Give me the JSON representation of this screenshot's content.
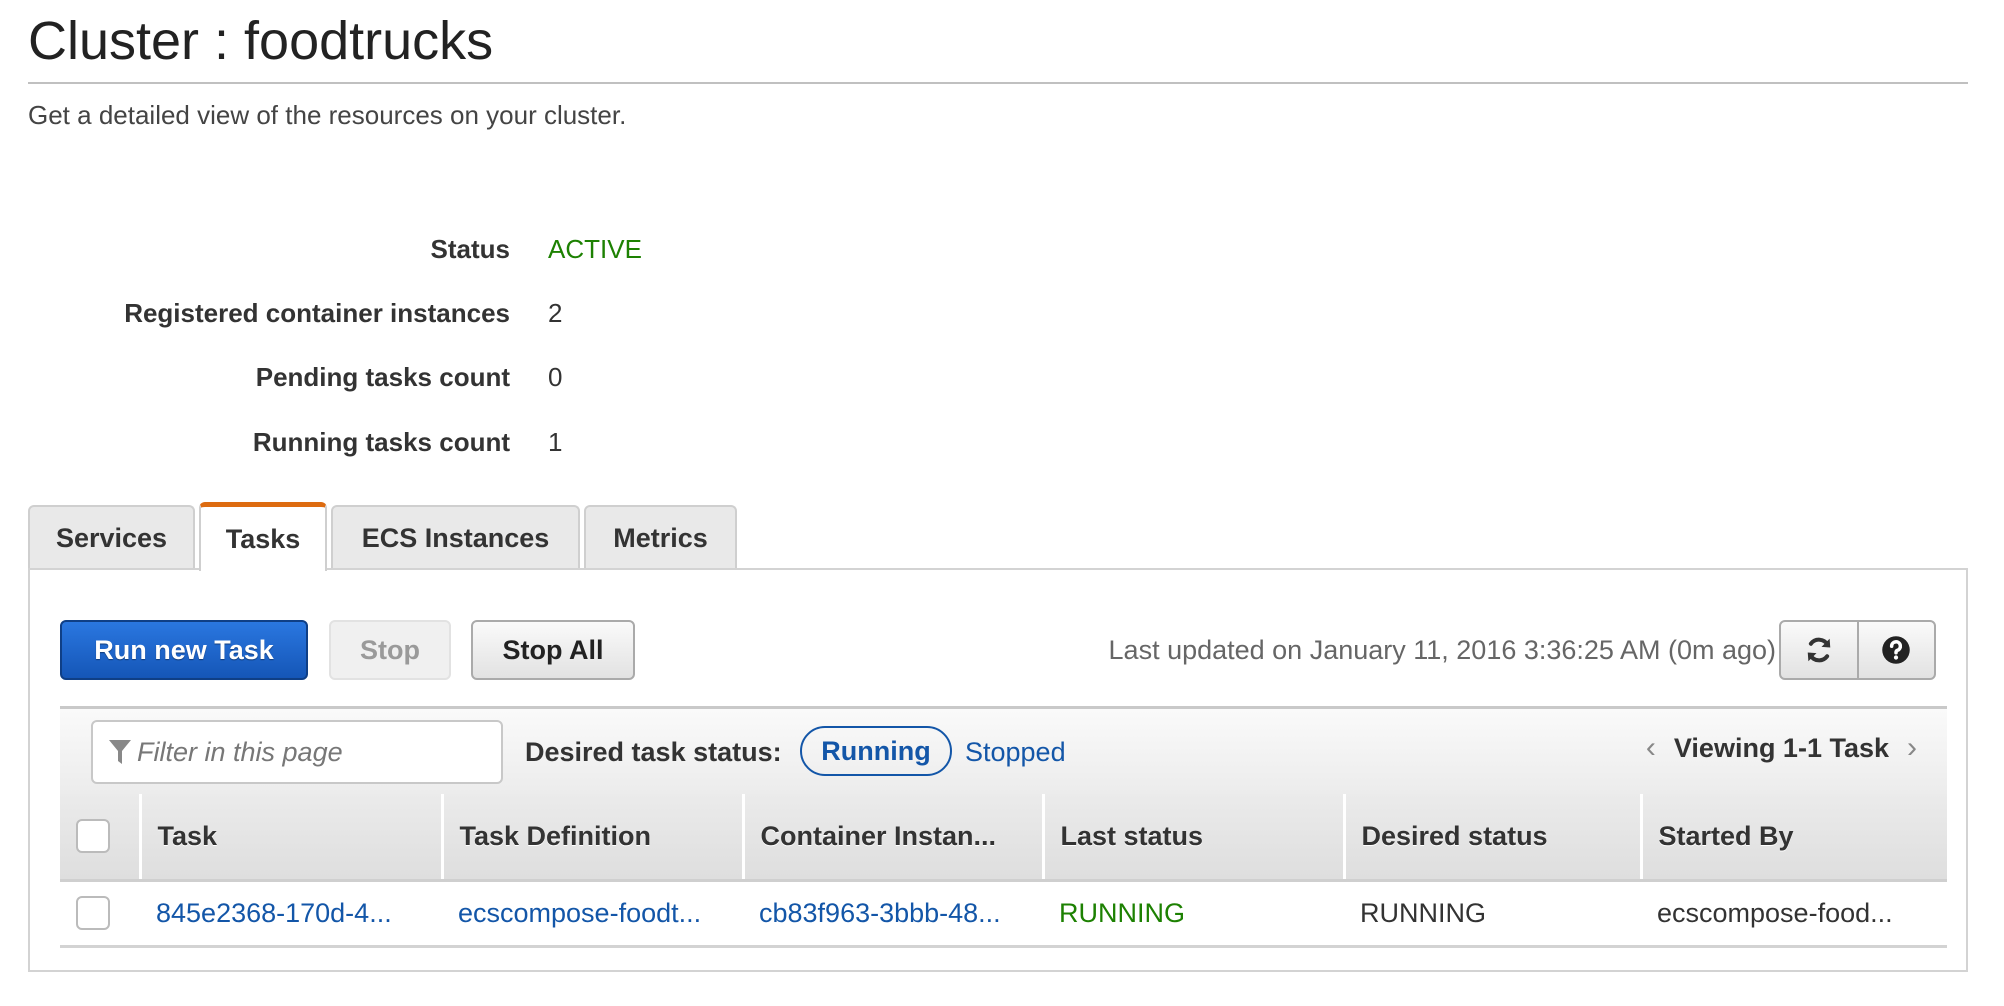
{
  "header": {
    "title": "Cluster : foodtrucks",
    "subtitle": "Get a detailed view of the resources on your cluster."
  },
  "details": [
    {
      "label": "Status",
      "value": "ACTIVE"
    },
    {
      "label": "Registered container instances",
      "value": "2"
    },
    {
      "label": "Pending tasks count",
      "value": "0"
    },
    {
      "label": "Running tasks count",
      "value": "1"
    }
  ],
  "colors": {
    "active_status": "#1d8102",
    "link": "#1356a8",
    "primary_button": "#1f66cc",
    "active_tab_accent": "#dd6b10"
  },
  "tabs": [
    {
      "label": "Services",
      "active": false
    },
    {
      "label": "Tasks",
      "active": true
    },
    {
      "label": "ECS Instances",
      "active": false
    },
    {
      "label": "Metrics",
      "active": false
    }
  ],
  "toolbar": {
    "run_label": "Run new Task",
    "stop_label": "Stop",
    "stop_all_label": "Stop All",
    "last_updated": "Last updated on January 11, 2016 3:36:25 AM (0m ago)",
    "refresh_icon": "refresh-icon",
    "help_icon": "help-icon"
  },
  "filter": {
    "placeholder": "Filter in this page",
    "icon": "filter-icon",
    "desired_label": "Desired task status:",
    "options": [
      "Running",
      "Stopped"
    ],
    "selected": "Running",
    "viewing": "Viewing 1-1 Task",
    "prev_icon": "chevron-left-icon",
    "next_icon": "chevron-right-icon"
  },
  "table": {
    "columns": [
      "Task",
      "Task Definition",
      "Container Instan...",
      "Last status",
      "Desired status",
      "Started By"
    ],
    "rows": [
      [
        "845e2368-170d-4...",
        "ecscompose-foodt...",
        "cb83f963-3bbb-48...",
        "RUNNING",
        "RUNNING",
        "ecscompose-food..."
      ]
    ]
  }
}
